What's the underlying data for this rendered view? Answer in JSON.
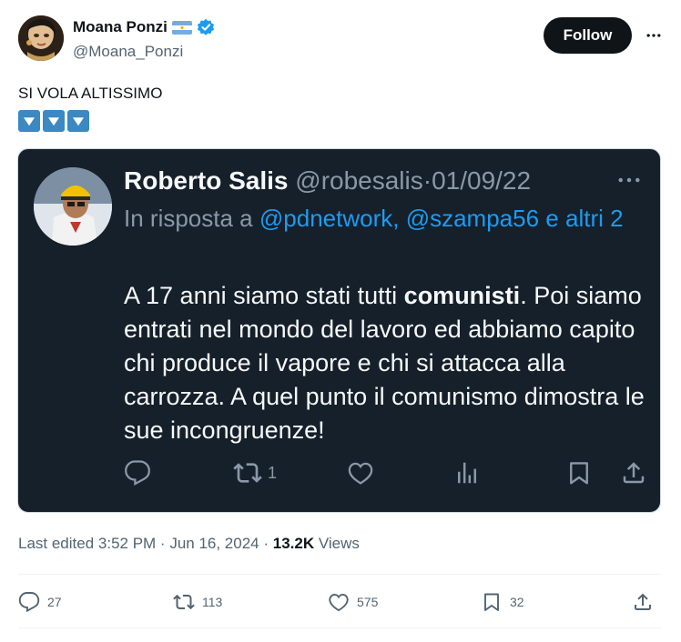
{
  "author": {
    "display_name": "Moana Ponzi",
    "handle": "@Moana_Ponzi",
    "flag_emoji": "argentina-flag",
    "verified": true,
    "follow_label": "Follow"
  },
  "tweet": {
    "text": "SI VOLA ALTISSIMO",
    "emoji_count": 3,
    "emoji_name": "down-arrow-button-emoji"
  },
  "quoted": {
    "display_name": "Roberto Salis",
    "handle": "@robesalis",
    "separator": "·",
    "date": "01/09/22",
    "reply_prefix": "In risposta a",
    "reply_link_1": "@pdnetwork,",
    "reply_link_2": "@szampa56",
    "reply_and": "e",
    "reply_others": "altri 2",
    "body_before": "A 17 anni siamo stati tutti ",
    "body_bold": "comunisti",
    "body_after": ". Poi siamo entrati nel mondo del lavoro ed abbiamo capito chi produce il vapore e chi si attacca alla carrozza. A quel punto il comunismo dimostra le sue incongruenze!",
    "retweet_count": "1"
  },
  "meta": {
    "edited_label": "Last edited 3:52 PM · Jun 16, 2024 ·",
    "views_count": "13.2K",
    "views_label": "Views"
  },
  "actions": {
    "replies": "27",
    "reposts": "113",
    "likes": "575",
    "bookmarks": "32"
  },
  "colors": {
    "accent": "#1d9bf0",
    "embed_bg": "#15202b",
    "muted": "#536471"
  }
}
